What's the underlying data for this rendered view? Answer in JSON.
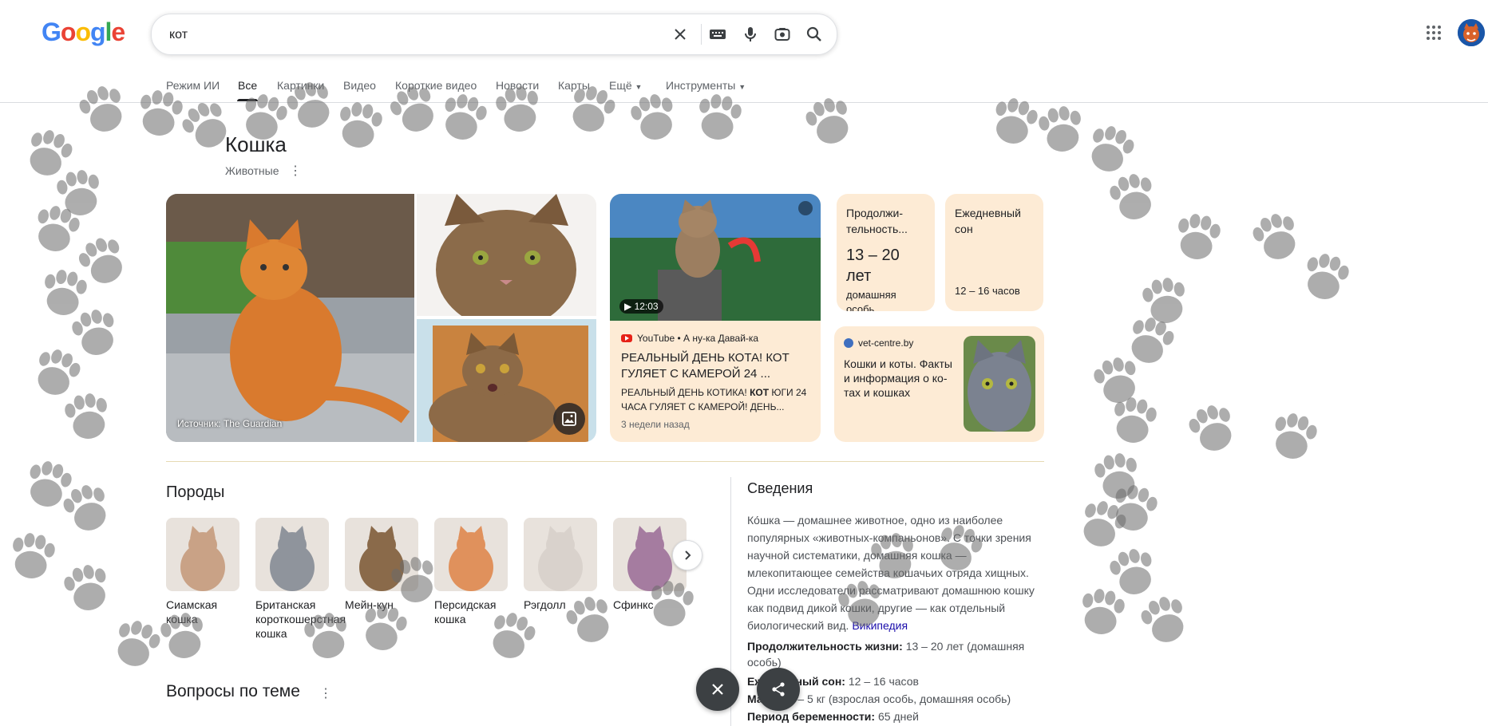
{
  "logo": {
    "text_g1": "G",
    "text_o1": "o",
    "text_o2": "o",
    "text_g2": "g",
    "text_l": "l",
    "text_e": "e"
  },
  "search": {
    "query": "кот"
  },
  "tabs": [
    {
      "label": "Режим ИИ"
    },
    {
      "label": "Все"
    },
    {
      "label": "Картинки"
    },
    {
      "label": "Видео"
    },
    {
      "label": "Короткие видео"
    },
    {
      "label": "Новости"
    },
    {
      "label": "Карты"
    },
    {
      "label": "Ещё"
    },
    {
      "label": "Инструменты"
    }
  ],
  "entity": {
    "title": "Кошка",
    "subtitle": "Животные"
  },
  "images": {
    "source": "Источник: The Guardian"
  },
  "video": {
    "duration": "12:03",
    "source": "YouTube • А ну-ка Давай-ка",
    "title": "РЕАЛЬНЫЙ ДЕНЬ КОТА! КОТ ГУЛЯЕТ С КАМЕРОЙ 24 ...",
    "snippet_before": "РЕАЛЬНЫЙ ДЕНЬ КОТИКА! ",
    "snippet_bold": "КОТ",
    "snippet_after": " ЮГИ 24 ЧАСА ГУЛЯЕТ С КАМЕРОЙ! ДЕНЬ...",
    "age": "3 недели назад"
  },
  "fact_cards": [
    {
      "label": "Продолжи-тельность...",
      "value": "13 – 20 лет",
      "note": "домашняя особь"
    },
    {
      "label": "Ежедневный сон",
      "value": "12 – 16 часов"
    }
  ],
  "article": {
    "site": "vet-centre.by",
    "title": "Кошки и коты. Факты и информация о ко-тах и кошках"
  },
  "breeds": {
    "title": "Породы",
    "items": [
      {
        "label": "Сиамская кошка",
        "color": "#c9a286"
      },
      {
        "label": "Британская короткошерстная кошка",
        "color": "#8f949c"
      },
      {
        "label": "Мейн-кун",
        "color": "#8a6a4a"
      },
      {
        "label": "Персидская кошка",
        "color": "#e0915c"
      },
      {
        "label": "Рэгдолл",
        "color": "#d9d2cc"
      },
      {
        "label": "Сфинкс",
        "color": "#a57ca0"
      }
    ]
  },
  "questions": {
    "title": "Вопросы по теме"
  },
  "facts": {
    "title": "Сведения",
    "desc": "Ко́шка — домашнее животное, одно из наиболее популярных «животных-компаньонов». С точки зрения научной систематики, домашняя кошка — млекопитающее семейства кошачьих отряда хищных. Одни исследователи рассматривают домашнюю кошку как подвид дикой кошки, другие — как отдельный биологический вид.",
    "wiki": "Википедия",
    "rows": [
      {
        "label": "Продолжительность жизни:",
        "value": " 13 – 20 лет (домашняя особь)"
      },
      {
        "label": "Ежедневный сон:",
        "value": " 12 – 16 часов"
      },
      {
        "label": "Масса:",
        "value": " 2 – 5 кг (взрослая особь, домашняя особь)"
      },
      {
        "label": "Период беременности:",
        "value": " 65 дней"
      }
    ]
  },
  "colors": {
    "card_bg": "#fdebd5",
    "link": "#1a0dab",
    "paw": "#6b6b6b"
  }
}
